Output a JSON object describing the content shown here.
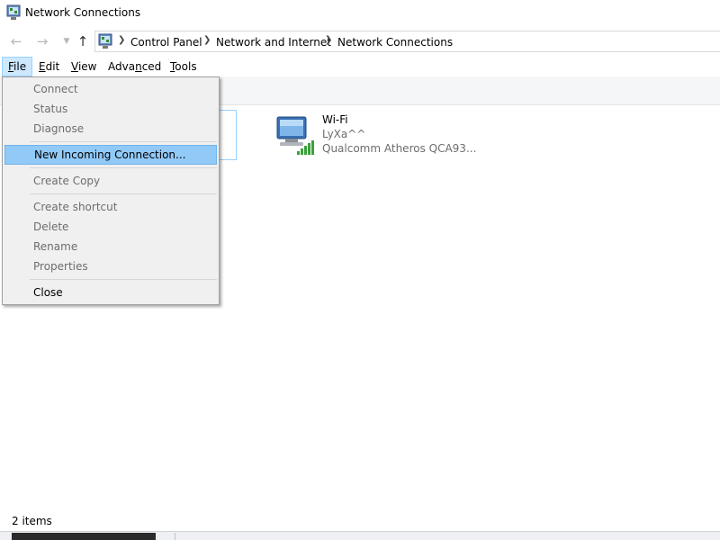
{
  "window": {
    "title": "Network Connections"
  },
  "navigation": {
    "back_icon": "arrow-left-icon",
    "forward_icon": "arrow-right-icon",
    "recent_icon": "chevron-down-icon",
    "up_icon": "arrow-up-icon",
    "breadcrumbs": [
      "Control Panel",
      "Network and Internet",
      "Network Connections"
    ]
  },
  "menubar": {
    "items": [
      {
        "label": "File",
        "accel": "F",
        "rest": "ile"
      },
      {
        "label": "Edit",
        "accel": "E",
        "rest": "dit"
      },
      {
        "label": "View",
        "accel": "V",
        "rest": "iew"
      },
      {
        "label": "Advanced",
        "pre": "Adva",
        "accel": "n",
        "rest": "ced"
      },
      {
        "label": "Tools",
        "accel": "T",
        "rest": "ools"
      }
    ]
  },
  "file_menu": {
    "items": [
      "Connect",
      "Status",
      "Diagnose",
      "New Incoming Connection...",
      "Create Copy",
      "Create shortcut",
      "Delete",
      "Rename",
      "Properties",
      "Close"
    ],
    "highlighted": "New Incoming Connection..."
  },
  "connections": [
    {
      "truncated_text": "..."
    },
    {
      "name": "Wi-Fi",
      "ssid": "LyXa^^",
      "adapter": "Qualcomm Atheros QCA93..."
    }
  ],
  "status": {
    "item_count": "2 items"
  },
  "colors": {
    "highlight": "#91c9f7",
    "menu_active": "#cce8ff",
    "disabled_text": "#6d6d6d",
    "signal_green": "#3aa13a"
  }
}
